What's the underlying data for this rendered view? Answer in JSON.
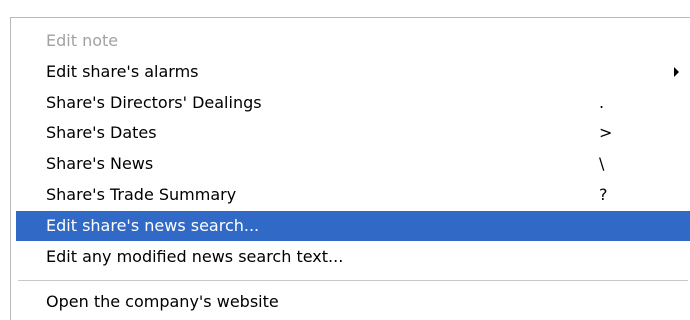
{
  "context_menu": {
    "items": [
      {
        "label": "Edit note",
        "shortcut": "",
        "state": "disabled"
      },
      {
        "label": "Edit share's alarms",
        "shortcut": "",
        "has_submenu": true
      },
      {
        "label": "Share's Directors' Dealings",
        "shortcut": "."
      },
      {
        "label": "Share's Dates",
        "shortcut": ">"
      },
      {
        "label": "Share's News",
        "shortcut": "\\"
      },
      {
        "label": "Share's Trade Summary",
        "shortcut": "?"
      },
      {
        "label": "Edit share's news search...",
        "shortcut": "",
        "state": "selected"
      },
      {
        "label": "Edit any modified news search text...",
        "shortcut": ""
      },
      {
        "label": "Open the company's website",
        "shortcut": ""
      }
    ],
    "colors": {
      "highlight": "#3169c6",
      "highlight_text": "#ffffff",
      "disabled_text": "#a2a2a2"
    }
  }
}
